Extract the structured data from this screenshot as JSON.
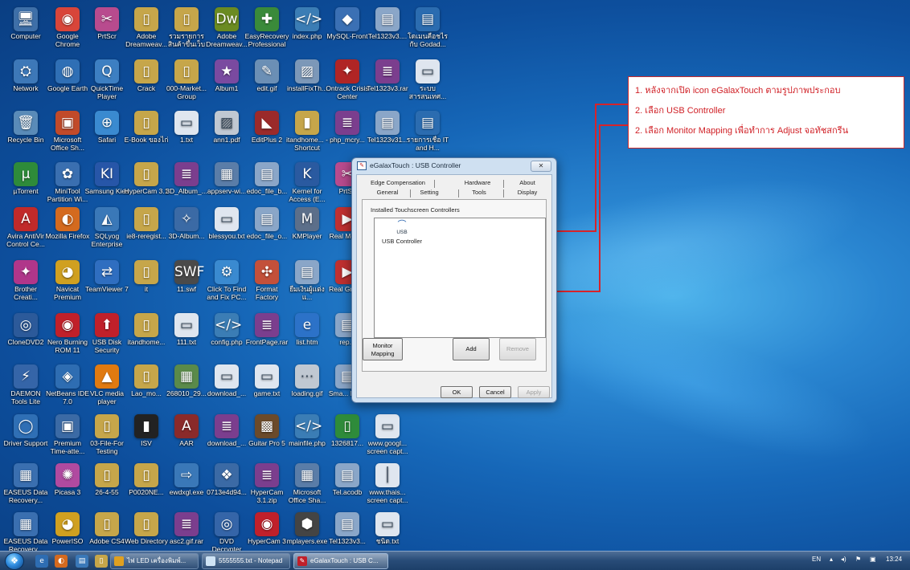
{
  "desktop": {
    "icons": [
      {
        "label": "Computer",
        "glyph": "🖥",
        "color": "#3e6fa8"
      },
      {
        "label": "Google Chrome",
        "glyph": "◉",
        "color": "#d8453a"
      },
      {
        "label": "PrtScr",
        "glyph": "✂",
        "color": "#b84b8e"
      },
      {
        "label": "Adobe Dreamweav...",
        "glyph": "▯",
        "color": "#c6a64a"
      },
      {
        "label": "รวมรายการสินค้าขึ้นเว็บ",
        "glyph": "▯",
        "color": "#c6a64a"
      },
      {
        "label": "Adobe Dreamweav...",
        "glyph": "Dw",
        "color": "#6b8b22"
      },
      {
        "label": "EasyRecovery Professional",
        "glyph": "✚",
        "color": "#3a8a3a"
      },
      {
        "label": "index.php",
        "glyph": "</>",
        "color": "#3b7db5"
      },
      {
        "label": "MySQL-Front",
        "glyph": "◆",
        "color": "#3b70b4"
      },
      {
        "label": "Tel1323v3....",
        "glyph": "▤",
        "color": "#8aa6c8"
      },
      {
        "label": "โดเมนคือชไรกับ Godad...",
        "glyph": "▤",
        "color": "#2b6cb0"
      },
      {
        "label": "Network",
        "glyph": "⛭",
        "color": "#3d78b8"
      },
      {
        "label": "Google Earth",
        "glyph": "◍",
        "color": "#2f6fb5"
      },
      {
        "label": "QuickTime Player",
        "glyph": "Q",
        "color": "#3d7fc2"
      },
      {
        "label": "Crack",
        "glyph": "▯",
        "color": "#c6a64a"
      },
      {
        "label": "000-Market... Group",
        "glyph": "▯",
        "color": "#c6a64a"
      },
      {
        "label": "Album1",
        "glyph": "★",
        "color": "#7a4aa0"
      },
      {
        "label": "edit.gif",
        "glyph": "✎",
        "color": "#6b8fb5"
      },
      {
        "label": "installFixTh...",
        "glyph": "▨",
        "color": "#7c98b8"
      },
      {
        "label": "Ontrack Crisis Center",
        "glyph": "✦",
        "color": "#b02525"
      },
      {
        "label": "Tel1323v3.rar",
        "glyph": "≣",
        "color": "#7b3e8e"
      },
      {
        "label": "ระบบ สารสนเทศ...",
        "glyph": "▭",
        "color": "#dfe6ef"
      },
      {
        "label": "Recycle Bin",
        "glyph": "🗑",
        "color": "#5a8bb8"
      },
      {
        "label": "Microsoft Office Sh...",
        "glyph": "▣",
        "color": "#c14a2a"
      },
      {
        "label": "Safari",
        "glyph": "⊕",
        "color": "#3a8ad0"
      },
      {
        "label": "E-Book ของไก่",
        "glyph": "▯",
        "color": "#c6a64a"
      },
      {
        "label": "1.txt",
        "glyph": "▭",
        "color": "#dfe6ef"
      },
      {
        "label": "ann1.pdf",
        "glyph": "▨",
        "color": "#c0c8d2"
      },
      {
        "label": "EditPlus 2",
        "glyph": "◣",
        "color": "#9b2a2a"
      },
      {
        "label": "itandhome... - Shortcut",
        "glyph": "▮",
        "color": "#c6a64a"
      },
      {
        "label": "php_mcry...",
        "glyph": "≣",
        "color": "#7b3e8e"
      },
      {
        "label": "Tel1323v31...",
        "glyph": "▤",
        "color": "#8aa6c8"
      },
      {
        "label": "รายการเชื่อ IT and H...",
        "glyph": "▤",
        "color": "#2b6cb0"
      },
      {
        "label": "µTorrent",
        "glyph": "µ",
        "color": "#2e8b3a"
      },
      {
        "label": "MiniTool Partition Wi...",
        "glyph": "✿",
        "color": "#3a6fb0"
      },
      {
        "label": "Samsung Kies",
        "glyph": "KI",
        "color": "#2756a8"
      },
      {
        "label": "HyperCam 3.1",
        "glyph": "▯",
        "color": "#c6a64a"
      },
      {
        "label": "3D_Album_...",
        "glyph": "≣",
        "color": "#7b3e8e"
      },
      {
        "label": "appserv-wi...",
        "glyph": "▦",
        "color": "#5a7da8"
      },
      {
        "label": "edoc_file_b...",
        "glyph": "▤",
        "color": "#8aa6c8"
      },
      {
        "label": "Kernel for Access (E...",
        "glyph": "K",
        "color": "#2a5aa0"
      },
      {
        "label": "PrtSc",
        "glyph": "✂",
        "color": "#b84b8e"
      },
      {
        "label": "Avira AntiVir Control Ce...",
        "glyph": "A",
        "color": "#c12a2a"
      },
      {
        "label": "Mozilla Firefox",
        "glyph": "◐",
        "color": "#d46a1f"
      },
      {
        "label": "SQLyog Enterprise",
        "glyph": "◭",
        "color": "#3a78b8"
      },
      {
        "label": "ie8-reregist...",
        "glyph": "▯",
        "color": "#c6a64a"
      },
      {
        "label": "3D-Album...",
        "glyph": "✧",
        "color": "#3b6aa5"
      },
      {
        "label": "blessyou.txt",
        "glyph": "▭",
        "color": "#dfe6ef"
      },
      {
        "label": "edoc_file_o...",
        "glyph": "▤",
        "color": "#8aa6c8"
      },
      {
        "label": "KMPlayer",
        "glyph": "M",
        "color": "#5c6f8a"
      },
      {
        "label": "Real Movi...",
        "glyph": "▶",
        "color": "#c03030"
      },
      {
        "label": "Brother Creati...",
        "glyph": "✦",
        "color": "#b0368a"
      },
      {
        "label": "Navicat Premium",
        "glyph": "◕",
        "color": "#d0a020"
      },
      {
        "label": "TeamViewer 7",
        "glyph": "⇄",
        "color": "#2f6ec0"
      },
      {
        "label": "it",
        "glyph": "▯",
        "color": "#c6a64a"
      },
      {
        "label": "11.swf",
        "glyph": "SWF",
        "color": "#4a4a4a"
      },
      {
        "label": "Click To Find and Fix PC...",
        "glyph": "⚙",
        "color": "#3a8ad0"
      },
      {
        "label": "Format Factory",
        "glyph": "✣",
        "color": "#c3503a"
      },
      {
        "label": "ยืมเงินผู้แต่งแ...",
        "glyph": "▤",
        "color": "#8aa6c8"
      },
      {
        "label": "Real Gree...",
        "glyph": "▶",
        "color": "#c03030"
      },
      {
        "label": "CloneDVD2",
        "glyph": "◎",
        "color": "#2c5a9a"
      },
      {
        "label": "Nero Burning ROM 11",
        "glyph": "◉",
        "color": "#c0202a"
      },
      {
        "label": "USB Disk Security",
        "glyph": "⬆",
        "color": "#c0202a"
      },
      {
        "label": "itandhome...",
        "glyph": "▯",
        "color": "#c6a64a"
      },
      {
        "label": "111.txt",
        "glyph": "▭",
        "color": "#dfe6ef"
      },
      {
        "label": "config.php",
        "glyph": "</>",
        "color": "#3b7db5"
      },
      {
        "label": "FrontPage.rar",
        "glyph": "≣",
        "color": "#7b3e8e"
      },
      {
        "label": "list.htm",
        "glyph": "e",
        "color": "#2c72c8"
      },
      {
        "label": "rep...",
        "glyph": "▤",
        "color": "#8aa6c8"
      },
      {
        "label": "DAEMON Tools Lite",
        "glyph": "⚡",
        "color": "#3565a8"
      },
      {
        "label": "NetBeans IDE 7.0",
        "glyph": "◈",
        "color": "#2e6db2"
      },
      {
        "label": "VLC media player",
        "glyph": "▲",
        "color": "#e07a10"
      },
      {
        "label": "Lao_mo...",
        "glyph": "▯",
        "color": "#c6a64a"
      },
      {
        "label": "268010_29...",
        "glyph": "▦",
        "color": "#5a8a4a"
      },
      {
        "label": "download_...",
        "glyph": "▭",
        "color": "#dfe6ef"
      },
      {
        "label": "game.txt",
        "glyph": "▭",
        "color": "#dfe6ef"
      },
      {
        "label": "loading.gif",
        "glyph": "⋯",
        "color": "#c0c8d2"
      },
      {
        "label": "Sma... RC...",
        "glyph": "▤",
        "color": "#8aa6c8"
      },
      {
        "label": "Driver Support",
        "glyph": "◯",
        "color": "#2f6fb5"
      },
      {
        "label": "Premium Time-atte...",
        "glyph": "▣",
        "color": "#3b6aa5"
      },
      {
        "label": "03-File-For Testing",
        "glyph": "▯",
        "color": "#c6a64a"
      },
      {
        "label": "ISV",
        "glyph": "▮",
        "color": "#222"
      },
      {
        "label": "AAR",
        "glyph": "A",
        "color": "#8a2a2a"
      },
      {
        "label": "download_...",
        "glyph": "≣",
        "color": "#7b3e8e"
      },
      {
        "label": "Guitar Pro 5",
        "glyph": "▩",
        "color": "#6b4a2a"
      },
      {
        "label": "mainfile.php",
        "glyph": "</>",
        "color": "#3b7db5"
      },
      {
        "label": "1326817...",
        "glyph": "▯",
        "color": "#2e8b3a"
      },
      {
        "label": "www.googl... screen capt...",
        "glyph": "▭",
        "color": "#dfe6ef"
      },
      {
        "label": "EASEUS Data Recovery...",
        "glyph": "▦",
        "color": "#3a6fb0"
      },
      {
        "label": "Picasa 3",
        "glyph": "✺",
        "color": "#b04aa0"
      },
      {
        "label": "26-4-55",
        "glyph": "▯",
        "color": "#c6a64a"
      },
      {
        "label": "P0020NE...",
        "glyph": "▯",
        "color": "#c6a64a"
      },
      {
        "label": "ewdxgl.exe",
        "glyph": "⇨",
        "color": "#3a78b8"
      },
      {
        "label": "0713e4d94...",
        "glyph": "❖",
        "color": "#3b6aa5"
      },
      {
        "label": "HyperCam 3.1.zip",
        "glyph": "≣",
        "color": "#7b3e8e"
      },
      {
        "label": "Microsoft Office Sha...",
        "glyph": "▦",
        "color": "#5a7da8"
      },
      {
        "label": "Tel.acodb",
        "glyph": "▤",
        "color": "#8aa6c8"
      },
      {
        "label": "www.thais... screen capt...",
        "glyph": "│",
        "color": "#dfe6ef"
      },
      {
        "label": "EASEUS Data Recovery...",
        "glyph": "▦",
        "color": "#3a6fb0"
      },
      {
        "label": "PowerISO",
        "glyph": "◕",
        "color": "#d0a020"
      },
      {
        "label": "Adobe CS4",
        "glyph": "▯",
        "color": "#c6a64a"
      },
      {
        "label": "Web Directory",
        "glyph": "▯",
        "color": "#c6a64a"
      },
      {
        "label": "asc2.gif.rar",
        "glyph": "≣",
        "color": "#7b3e8e"
      },
      {
        "label": "DVD Decrypter",
        "glyph": "◎",
        "color": "#3565a8"
      },
      {
        "label": "HyperCam 3",
        "glyph": "◉",
        "color": "#c0202a"
      },
      {
        "label": "mplayers.exe",
        "glyph": "⬢",
        "color": "#444"
      },
      {
        "label": "Tel1323v3...",
        "glyph": "▤",
        "color": "#8aa6c8"
      },
      {
        "label": "ชนิด.txt",
        "glyph": "▭",
        "color": "#dfe6ef"
      }
    ]
  },
  "dialog": {
    "title": "eGalaxTouch : USB Controller",
    "close_label": "✕",
    "tabs_row1": [
      "Edge Compensation",
      "Hardware",
      "About"
    ],
    "tabs_row2": [
      "General",
      "Setting",
      "Tools",
      "Display"
    ],
    "group_label": "Installed Touchscreen Controllers",
    "controller": {
      "badge": "USB",
      "name": "USB Controller"
    },
    "buttons": {
      "monitor_mapping": "Monitor Mapping",
      "add": "Add",
      "remove": "Remove",
      "ok": "OK",
      "cancel": "Cancel",
      "apply": "Apply"
    }
  },
  "annotations": {
    "line1": "1. หลังจากเปิด icon eGalaxTouch ตามรูปภาพประกอบ",
    "line2": "2. เลือก USB Controller",
    "line3": "2. เลือก Monitor Mapping เพื่อทำการ Adjust จอทัชสกรีน",
    "color": "#d01f25"
  },
  "taskbar": {
    "windows": [
      {
        "label": "ไฟ LED เครื่องพิมพ์...",
        "icon": "folder-icon",
        "color": "#e0a020"
      },
      {
        "label": "5555555.txt - Notepad",
        "icon": "notepad-icon",
        "color": "#cfe3f5"
      },
      {
        "label": "eGalaxTouch : USB C...",
        "icon": "egalax-icon",
        "color": "#c0202a"
      }
    ],
    "language": "EN",
    "clock": "13:24"
  }
}
